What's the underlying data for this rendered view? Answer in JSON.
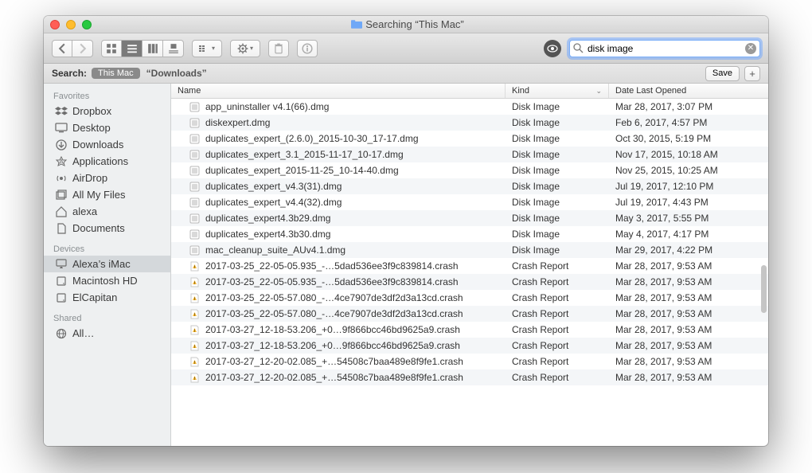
{
  "window": {
    "title": "Searching “This Mac”"
  },
  "toolbar": {
    "search_value": "disk image"
  },
  "searchbar": {
    "label": "Search:",
    "scope_active": "This Mac",
    "scope_other": "“Downloads”",
    "save_label": "Save"
  },
  "sidebar": {
    "favorites_label": "Favorites",
    "devices_label": "Devices",
    "shared_label": "Shared",
    "favorites": [
      {
        "label": "Dropbox",
        "icon": "dropbox"
      },
      {
        "label": "Desktop",
        "icon": "desktop"
      },
      {
        "label": "Downloads",
        "icon": "downloads"
      },
      {
        "label": "Applications",
        "icon": "applications"
      },
      {
        "label": "AirDrop",
        "icon": "airdrop"
      },
      {
        "label": "All My Files",
        "icon": "allfiles"
      },
      {
        "label": "alexa",
        "icon": "home"
      },
      {
        "label": "Documents",
        "icon": "documents"
      }
    ],
    "devices": [
      {
        "label": "Alexa’s iMac",
        "icon": "imac",
        "selected": true
      },
      {
        "label": "Macintosh HD",
        "icon": "disk"
      },
      {
        "label": "ElCapitan",
        "icon": "disk"
      }
    ],
    "shared": [
      {
        "label": "All…",
        "icon": "globe"
      }
    ]
  },
  "columns": {
    "name": "Name",
    "kind": "Kind",
    "date": "Date Last Opened"
  },
  "rows": [
    {
      "icon": "dmg",
      "name": "app_uninstaller v4.1(66).dmg",
      "kind": "Disk Image",
      "date": "Mar 28, 2017, 3:07 PM"
    },
    {
      "icon": "dmg",
      "name": "diskexpert.dmg",
      "kind": "Disk Image",
      "date": "Feb 6, 2017, 4:57 PM"
    },
    {
      "icon": "dmg",
      "name": "duplicates_expert_(2.6.0)_2015-10-30_17-17.dmg",
      "kind": "Disk Image",
      "date": "Oct 30, 2015, 5:19 PM"
    },
    {
      "icon": "dmg",
      "name": "duplicates_expert_3.1_2015-11-17_10-17.dmg",
      "kind": "Disk Image",
      "date": "Nov 17, 2015, 10:18 AM"
    },
    {
      "icon": "dmg",
      "name": "duplicates_expert_2015-11-25_10-14-40.dmg",
      "kind": "Disk Image",
      "date": "Nov 25, 2015, 10:25 AM"
    },
    {
      "icon": "dmg",
      "name": "duplicates_expert_v4.3(31).dmg",
      "kind": "Disk Image",
      "date": "Jul 19, 2017, 12:10 PM"
    },
    {
      "icon": "dmg",
      "name": "duplicates_expert_v4.4(32).dmg",
      "kind": "Disk Image",
      "date": "Jul 19, 2017, 4:43 PM"
    },
    {
      "icon": "dmg",
      "name": "duplicates_expert4.3b29.dmg",
      "kind": "Disk Image",
      "date": "May 3, 2017, 5:55 PM"
    },
    {
      "icon": "dmg",
      "name": "duplicates_expert4.3b30.dmg",
      "kind": "Disk Image",
      "date": "May 4, 2017, 4:17 PM"
    },
    {
      "icon": "dmg",
      "name": "mac_cleanup_suite_AUv4.1.dmg",
      "kind": "Disk Image",
      "date": "Mar 29, 2017, 4:22 PM"
    },
    {
      "icon": "crash",
      "name": "2017-03-25_22-05-05.935_-…5dad536ee3f9c839814.crash",
      "kind": "Crash Report",
      "date": "Mar 28, 2017, 9:53 AM"
    },
    {
      "icon": "crash",
      "name": "2017-03-25_22-05-05.935_-…5dad536ee3f9c839814.crash",
      "kind": "Crash Report",
      "date": "Mar 28, 2017, 9:53 AM"
    },
    {
      "icon": "crash",
      "name": "2017-03-25_22-05-57.080_-…4ce7907de3df2d3a13cd.crash",
      "kind": "Crash Report",
      "date": "Mar 28, 2017, 9:53 AM"
    },
    {
      "icon": "crash",
      "name": "2017-03-25_22-05-57.080_-…4ce7907de3df2d3a13cd.crash",
      "kind": "Crash Report",
      "date": "Mar 28, 2017, 9:53 AM"
    },
    {
      "icon": "crash",
      "name": "2017-03-27_12-18-53.206_+0…9f866bcc46bd9625a9.crash",
      "kind": "Crash Report",
      "date": "Mar 28, 2017, 9:53 AM"
    },
    {
      "icon": "crash",
      "name": "2017-03-27_12-18-53.206_+0…9f866bcc46bd9625a9.crash",
      "kind": "Crash Report",
      "date": "Mar 28, 2017, 9:53 AM"
    },
    {
      "icon": "crash",
      "name": "2017-03-27_12-20-02.085_+…54508c7baa489e8f9fe1.crash",
      "kind": "Crash Report",
      "date": "Mar 28, 2017, 9:53 AM"
    },
    {
      "icon": "crash",
      "name": "2017-03-27_12-20-02.085_+…54508c7baa489e8f9fe1.crash",
      "kind": "Crash Report",
      "date": "Mar 28, 2017, 9:53 AM"
    }
  ]
}
